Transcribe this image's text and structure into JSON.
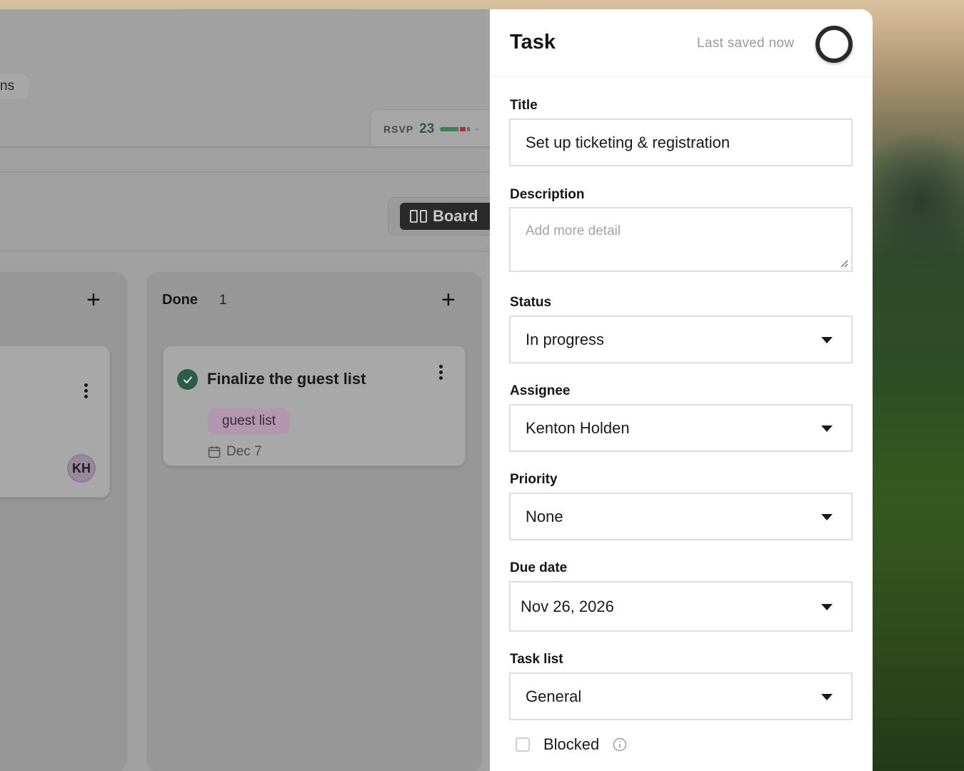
{
  "board": {
    "tab_fragment": "ns",
    "rsvp": {
      "label": "RSVP",
      "count": "23"
    },
    "view_switch": {
      "board_label": "Board"
    },
    "columns": [
      {
        "title": "",
        "count": ""
      },
      {
        "title": "Done",
        "count": "1"
      }
    ],
    "left_card": {
      "avatar_initials": "KH"
    },
    "done_card": {
      "title": "Finalize the guest list",
      "tag": "guest list",
      "due": "Dec 7"
    }
  },
  "panel": {
    "title": "Task",
    "saved_status": "Last saved now",
    "fields": {
      "title_label": "Title",
      "title_value": "Set up ticketing & registration",
      "description_label": "Description",
      "description_placeholder": "Add more detail",
      "status_label": "Status",
      "status_value": "In progress",
      "assignee_label": "Assignee",
      "assignee_value": "Kenton Holden",
      "priority_label": "Priority",
      "priority_value": "None",
      "due_label": "Due date",
      "due_value": "Nov 26, 2026",
      "tasklist_label": "Task list",
      "tasklist_value": "General",
      "blocked_label": "Blocked"
    }
  },
  "colors": {
    "done_check": "#2a5d47",
    "tag_bg": "#b497ae",
    "rsvp_count": "#2d5a4a"
  }
}
